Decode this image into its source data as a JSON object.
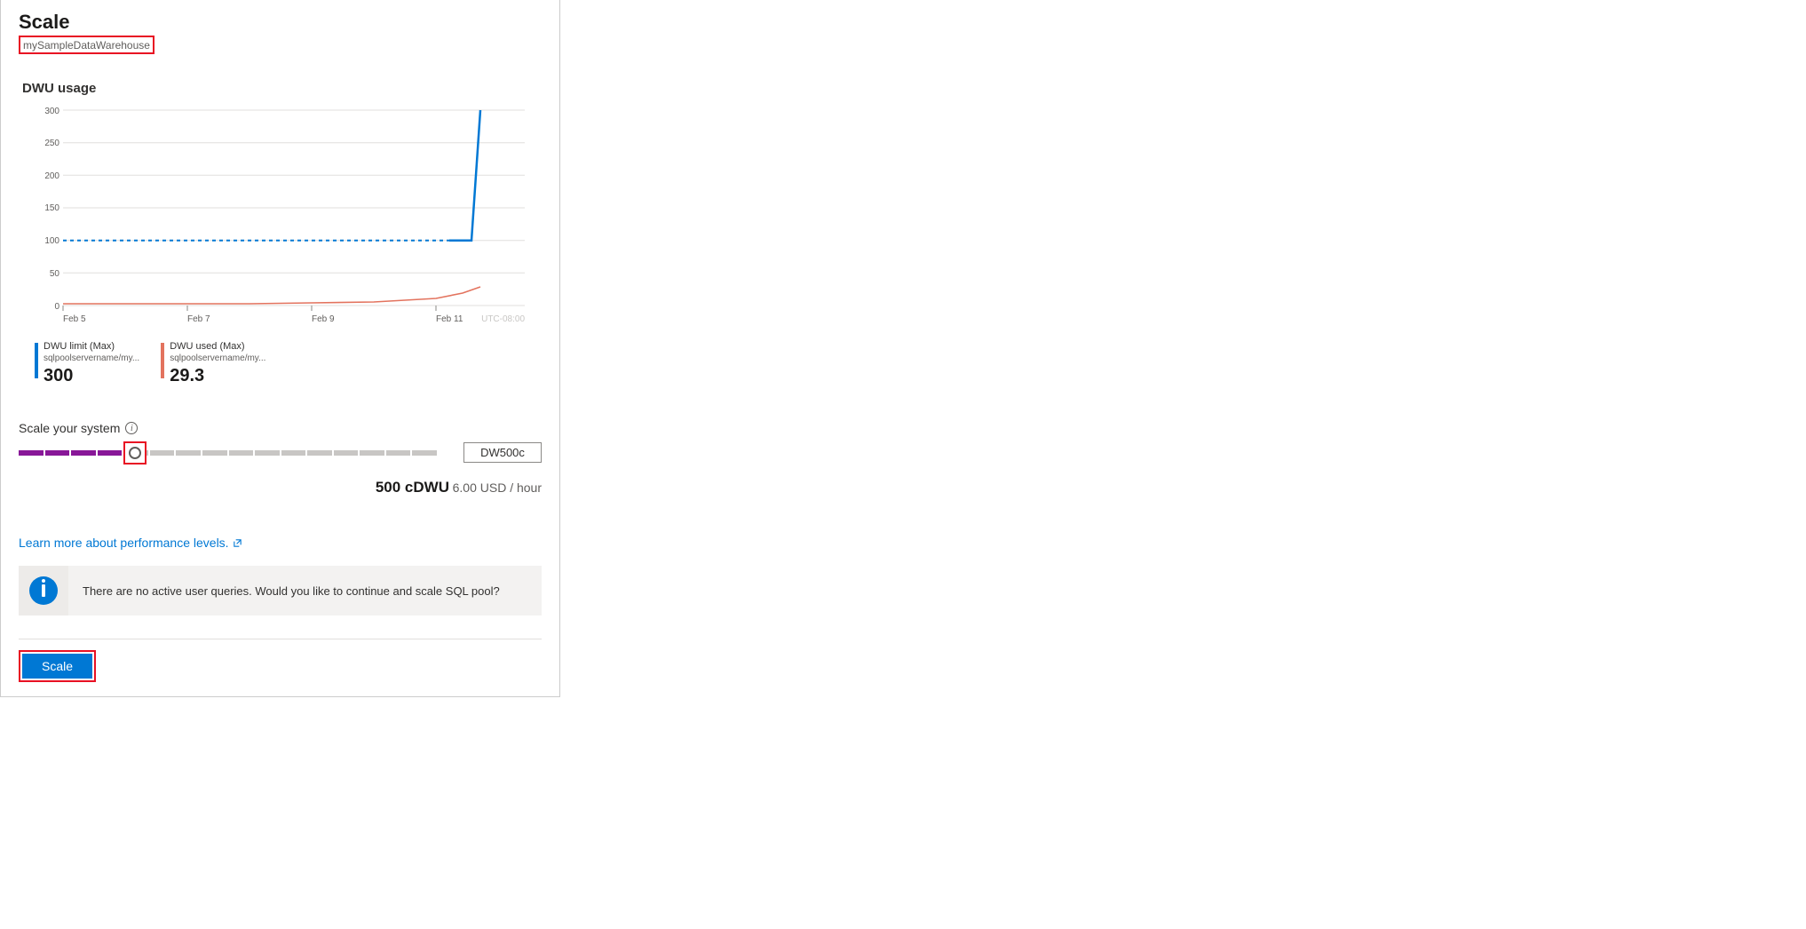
{
  "header": {
    "title": "Scale",
    "resource_name": "mySampleDataWarehouse"
  },
  "usage": {
    "section_title": "DWU usage"
  },
  "chart_data": {
    "type": "line",
    "xlabel": "",
    "ylabel": "",
    "ylim": [
      0,
      300
    ],
    "x_categories": [
      "Feb 5",
      "Feb 7",
      "Feb 9",
      "Feb 11"
    ],
    "y_ticks": [
      0,
      50,
      100,
      150,
      200,
      250,
      300
    ],
    "tz_label": "UTC-08:00",
    "series": [
      {
        "name": "DWU limit (Max)",
        "color": "#0078d4",
        "style_note": "dashed then solid spike",
        "points": [
          {
            "x": "Feb 5",
            "y": 100
          },
          {
            "x": "Feb 6",
            "y": 100
          },
          {
            "x": "Feb 7",
            "y": 100
          },
          {
            "x": "Feb 8",
            "y": 100
          },
          {
            "x": "Feb 9",
            "y": 100
          },
          {
            "x": "Feb 10",
            "y": 100
          },
          {
            "x": "Feb 10.5",
            "y": 100
          },
          {
            "x": "Feb 11",
            "y": 300
          }
        ]
      },
      {
        "name": "DWU used (Max)",
        "color": "#e3735e",
        "points": [
          {
            "x": "Feb 5",
            "y": 2
          },
          {
            "x": "Feb 6",
            "y": 2
          },
          {
            "x": "Feb 7",
            "y": 2
          },
          {
            "x": "Feb 8",
            "y": 2
          },
          {
            "x": "Feb 9",
            "y": 3
          },
          {
            "x": "Feb 10",
            "y": 5
          },
          {
            "x": "Feb 10.5",
            "y": 10
          },
          {
            "x": "Feb 11",
            "y": 29
          }
        ]
      }
    ]
  },
  "legend": [
    {
      "title": "DWU limit (Max)",
      "subtitle": "sqlpoolservername/my...",
      "value": "300",
      "color": "#0078d4"
    },
    {
      "title": "DWU used (Max)",
      "subtitle": "sqlpoolservername/my...",
      "value": "29.3",
      "color": "#e3735e"
    }
  ],
  "slider": {
    "label": "Scale your system",
    "selected_value": "DW500c",
    "segments_total": 16,
    "segments_active": 4
  },
  "pricing": {
    "value_label": "500 cDWU",
    "rate_label": "6.00 USD / hour"
  },
  "link": {
    "text": "Learn more about performance levels."
  },
  "banner": {
    "message": "There are no active user queries. Would you like to continue and scale SQL pool?"
  },
  "action": {
    "label": "Scale"
  }
}
